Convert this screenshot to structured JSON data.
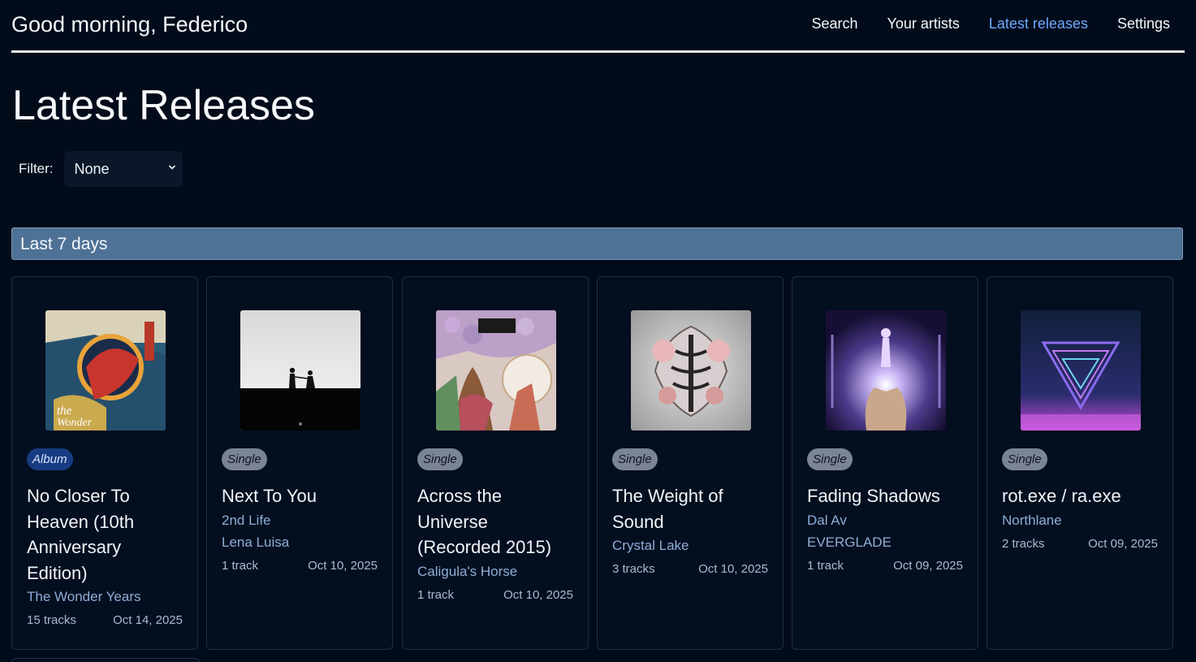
{
  "header": {
    "greeting": "Good morning, Federico",
    "nav": [
      {
        "label": "Search",
        "active": false
      },
      {
        "label": "Your artists",
        "active": false
      },
      {
        "label": "Latest releases",
        "active": true
      },
      {
        "label": "Settings",
        "active": false
      }
    ]
  },
  "page": {
    "title": "Latest Releases",
    "filter_label": "Filter:",
    "filter_value": "None"
  },
  "section": {
    "title": "Last 7 days"
  },
  "colors": {
    "background": "#020b1a",
    "accent": "#6ea8fe",
    "section_bar": "#4e7196",
    "album_badge": "#173b82",
    "single_badge": "#7a8494",
    "artist_link": "#8eaed6"
  },
  "releases": [
    {
      "type": "Album",
      "title": "No Closer To Heaven (10th Anniversary Edition)",
      "artists": [
        "The Wonder Years"
      ],
      "tracks": "15 tracks",
      "date": "Oct 14, 2025",
      "cover_icon": "album-cover-art"
    },
    {
      "type": "Single",
      "title": "Next To You",
      "artists": [
        "2nd Life",
        "Lena Luisa"
      ],
      "tracks": "1 track",
      "date": "Oct 10, 2025",
      "cover_icon": "album-cover-art"
    },
    {
      "type": "Single",
      "title": "Across the Universe (Recorded 2015)",
      "artists": [
        "Caligula's Horse"
      ],
      "tracks": "1 track",
      "date": "Oct 10, 2025",
      "cover_icon": "album-cover-art"
    },
    {
      "type": "Single",
      "title": "The Weight of Sound",
      "artists": [
        "Crystal Lake"
      ],
      "tracks": "3 tracks",
      "date": "Oct 10, 2025",
      "cover_icon": "album-cover-art"
    },
    {
      "type": "Single",
      "title": "Fading Shadows",
      "artists": [
        "Dal Av",
        "EVERGLADE"
      ],
      "tracks": "1 track",
      "date": "Oct 09, 2025",
      "cover_icon": "album-cover-art"
    },
    {
      "type": "Single",
      "title": "rot.exe / ra.exe",
      "artists": [
        "Northlane"
      ],
      "tracks": "2 tracks",
      "date": "Oct 09, 2025",
      "cover_icon": "album-cover-art"
    }
  ]
}
